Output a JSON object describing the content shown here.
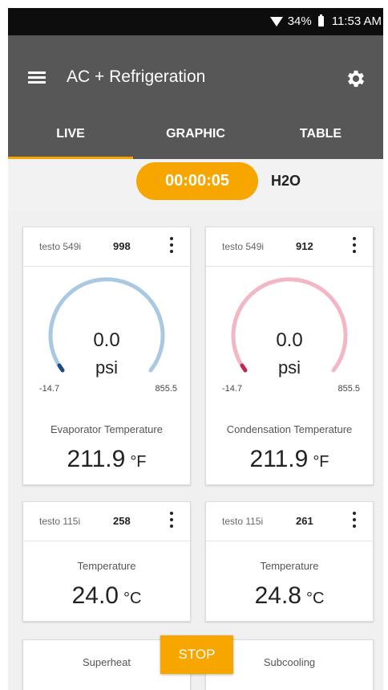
{
  "status_bar": {
    "battery": "34%",
    "time": "11:53 AM"
  },
  "app_bar": {
    "title": "AC + Refrigeration"
  },
  "tabs": [
    {
      "label": "LIVE",
      "active": true
    },
    {
      "label": "GRAPHIC",
      "active": false
    },
    {
      "label": "TABLE",
      "active": false
    }
  ],
  "timer": {
    "elapsed": "00:00:05",
    "medium": "H2O"
  },
  "cards": [
    {
      "device": "testo 549i",
      "serial": "998",
      "gauge_value": "0.0",
      "gauge_unit": "psi",
      "gauge_min": "-14.7",
      "gauge_max": "855.5",
      "gauge_color": "#a9c9e2",
      "gauge_marker": "#1f4e80",
      "name": "Evaporator Temperature",
      "value": "211.9",
      "unit": "°F"
    },
    {
      "device": "testo 549i",
      "serial": "912",
      "gauge_value": "0.0",
      "gauge_unit": "psi",
      "gauge_min": "-14.7",
      "gauge_max": "855.5",
      "gauge_color": "#f2b6c4",
      "gauge_marker": "#c0264f",
      "name": "Condensation Temperature",
      "value": "211.9",
      "unit": "°F"
    },
    {
      "device": "testo 115i",
      "serial": "258",
      "name": "Temperature",
      "value": "24.0",
      "unit": "°C"
    },
    {
      "device": "testo 115i",
      "serial": "261",
      "name": "Temperature",
      "value": "24.8",
      "unit": "°C"
    },
    {
      "name": "Superheat"
    },
    {
      "name": "Subcooling"
    }
  ],
  "stop_button": {
    "label": "STOP"
  },
  "colors": {
    "accent": "#f7a600",
    "app_bar": "#575757",
    "status_bar": "#0d0d0d"
  }
}
